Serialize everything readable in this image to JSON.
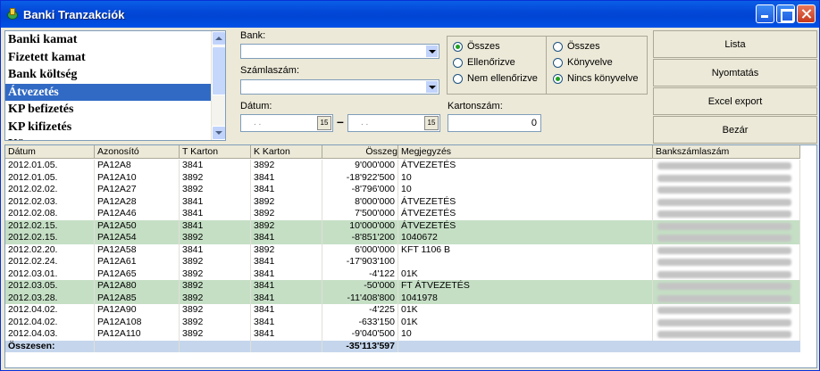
{
  "window": {
    "title": "Banki Tranzakciók"
  },
  "categories": [
    {
      "label": "Banki kamat",
      "selected": false
    },
    {
      "label": "Fizetett kamat",
      "selected": false
    },
    {
      "label": "Bank költség",
      "selected": false
    },
    {
      "label": "Átvezetés",
      "selected": true
    },
    {
      "label": "KP befizetés",
      "selected": false
    },
    {
      "label": "KP kifizetés",
      "selected": false
    },
    {
      "label": "Kö...",
      "selected": false
    }
  ],
  "filters": {
    "bank_label": "Bank:",
    "account_label": "Számlaszám:",
    "date_label": "Dátum:",
    "date_from": ". .",
    "date_to": ". .",
    "card_label": "Kartonszám:",
    "card_value": "0"
  },
  "radio_left": [
    {
      "label": "Összes",
      "checked": true
    },
    {
      "label": "Ellenőrizve",
      "checked": false
    },
    {
      "label": "Nem ellenőrizve",
      "checked": false
    }
  ],
  "radio_right": [
    {
      "label": "Összes",
      "checked": false
    },
    {
      "label": "Könyvelve",
      "checked": false
    },
    {
      "label": "Nincs könyvelve",
      "checked": true
    }
  ],
  "buttons": {
    "list": "Lista",
    "print": "Nyomtatás",
    "excel": "Excel export",
    "close": "Bezár"
  },
  "grid": {
    "headers": [
      "Dátum",
      "Azonosító",
      "T Karton",
      "K Karton",
      "Összeg",
      "Megjegyzés",
      "Bankszámlaszám"
    ],
    "rows": [
      {
        "date": "2012.01.05.",
        "id": "PA12A8",
        "t": "3841",
        "k": "3892",
        "amount": "9'000'000",
        "note": "ÁTVEZETÉS",
        "green": false
      },
      {
        "date": "2012.01.05.",
        "id": "PA12A10",
        "t": "3892",
        "k": "3841",
        "amount": "-18'922'500",
        "note": "10",
        "green": false
      },
      {
        "date": "2012.02.02.",
        "id": "PA12A27",
        "t": "3892",
        "k": "3841",
        "amount": "-8'796'000",
        "note": "10",
        "green": false
      },
      {
        "date": "2012.02.03.",
        "id": "PA12A28",
        "t": "3841",
        "k": "3892",
        "amount": "8'000'000",
        "note": "ÁTVEZETÉS",
        "green": false
      },
      {
        "date": "2012.02.08.",
        "id": "PA12A46",
        "t": "3841",
        "k": "3892",
        "amount": "7'500'000",
        "note": "ÁTVEZETÉS",
        "green": false
      },
      {
        "date": "2012.02.15.",
        "id": "PA12A50",
        "t": "3841",
        "k": "3892",
        "amount": "10'000'000",
        "note": "ÁTVEZETÉS",
        "green": true
      },
      {
        "date": "2012.02.15.",
        "id": "PA12A54",
        "t": "3892",
        "k": "3841",
        "amount": "-8'851'200",
        "note": "1040672",
        "green": true
      },
      {
        "date": "2012.02.20.",
        "id": "PA12A58",
        "t": "3841",
        "k": "3892",
        "amount": "6'000'000",
        "note": "KFT 1106 B",
        "green": false
      },
      {
        "date": "2012.02.24.",
        "id": "PA12A61",
        "t": "3892",
        "k": "3841",
        "amount": "-17'903'100",
        "note": "",
        "green": false
      },
      {
        "date": "2012.03.01.",
        "id": "PA12A65",
        "t": "3892",
        "k": "3841",
        "amount": "-4'122",
        "note": "01K",
        "green": false
      },
      {
        "date": "2012.03.05.",
        "id": "PA12A80",
        "t": "3892",
        "k": "3841",
        "amount": "-50'000",
        "note": "FT ÁTVEZETÉS",
        "green": true
      },
      {
        "date": "2012.03.28.",
        "id": "PA12A85",
        "t": "3892",
        "k": "3841",
        "amount": "-11'408'800",
        "note": "1041978",
        "green": true
      },
      {
        "date": "2012.04.02.",
        "id": "PA12A90",
        "t": "3892",
        "k": "3841",
        "amount": "-4'225",
        "note": "01K",
        "green": false
      },
      {
        "date": "2012.04.02.",
        "id": "PA12A108",
        "t": "3892",
        "k": "3841",
        "amount": "-633'150",
        "note": "01K",
        "green": false
      },
      {
        "date": "2012.04.03.",
        "id": "PA12A110",
        "t": "3892",
        "k": "3841",
        "amount": "-9'040'500",
        "note": "10",
        "green": false
      }
    ],
    "total_label": "Összesen:",
    "total_amount": "-35'113'597"
  }
}
